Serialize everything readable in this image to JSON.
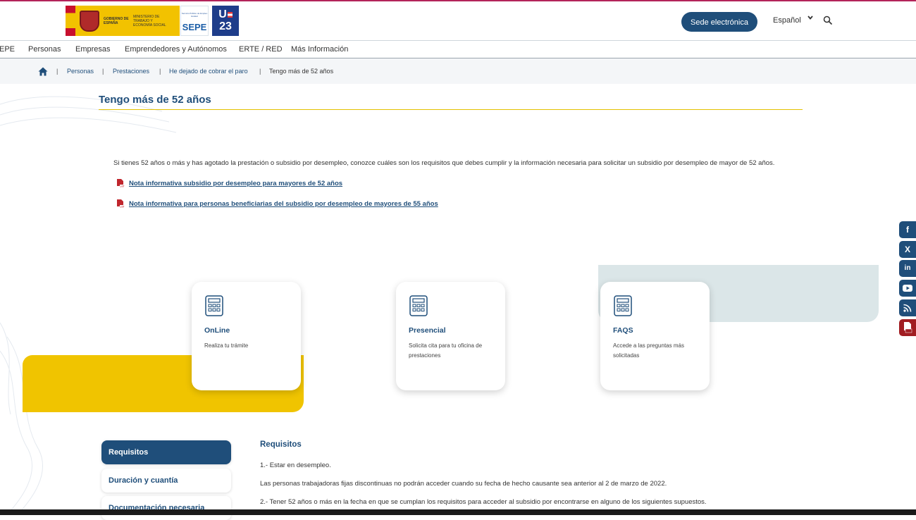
{
  "header": {
    "gov_logo_text": "Gobierno de España",
    "ministry_text": "Ministerio de Trabajo y Economía Social",
    "sepe_small": "Servicio Público de Empleo Estatal",
    "sepe_label": "SEPE",
    "ue_top": "U",
    "ue_bottom": "23",
    "sede_button": "Sede electrónica",
    "language": "Español"
  },
  "nav": {
    "items": [
      "EPE",
      "Personas",
      "Empresas",
      "Emprendedores y Autónomos",
      "ERTE / RED",
      "Más Información"
    ]
  },
  "breadcrumb": {
    "items": [
      "Personas",
      "Prestaciones",
      "He dejado de cobrar el paro",
      "Tengo más de 52 años"
    ]
  },
  "page": {
    "title": "Tengo más de 52 años",
    "intro": "Si tienes 52 años o más y has agotado la prestación o subsidio por desempleo, conozce cuáles son los requisitos que debes cumplir y la información necesaria para solicitar un subsidio por desempleo de mayor de 52 años.",
    "links": [
      "Nota informativa subsidio por desempleo para mayores de 52 años",
      "Nota informativa para personas beneficiarias del subsidio por desempleo de mayores de 55 años"
    ]
  },
  "cards": [
    {
      "title": "OnLine",
      "desc": "Realiza tu trámite"
    },
    {
      "title": "Presencial",
      "desc": "Solicita cita para tu oficina de prestaciones"
    },
    {
      "title": "FAQS",
      "desc": "Accede a las preguntas más solicitadas"
    }
  ],
  "social": [
    "f",
    "X",
    "in",
    "▶",
    "rss",
    "pdf"
  ],
  "tabs": [
    "Requisitos",
    "Duración y cuantía",
    "Documentación necesaria"
  ],
  "requirements": {
    "heading": "Requisitos",
    "lines": [
      "1.- Estar en desempleo.",
      "Las personas trabajadoras fijas discontinuas no podrán acceder cuando su fecha de hecho causante sea anterior al 2 de marzo de 2022.",
      "2.- Tener 52 años o más en la fecha en que se cumplan los requisitos para acceder al subsidio por encontrarse en alguno de los siguientes supuestos."
    ]
  },
  "colors": {
    "primary": "#1f4e7a",
    "accent_yellow": "#f0c400",
    "accent_teal": "#dbe6e8",
    "pdf_red": "#c0262d"
  }
}
